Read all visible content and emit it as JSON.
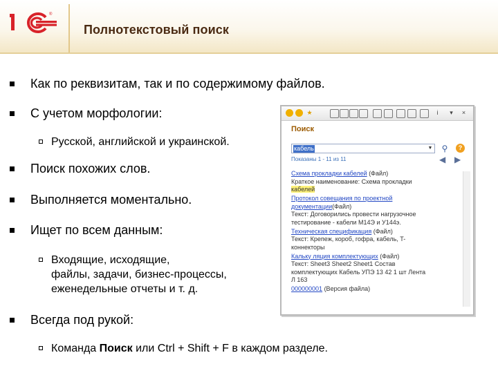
{
  "header": {
    "title": "Полнотекстовый поиск"
  },
  "bullets": [
    "Как по реквизитам, так и по содержимому файлов.",
    "С учетом морфологии:",
    "Поиск похожих слов.",
    "Выполняется моментально.",
    "Ищет по всем данным:",
    "Всегда под рукой:"
  ],
  "subbullets": {
    "morph": "Русской, английской и украинской.",
    "data_l1": "Входящие, исходящие,",
    "data_l2": "файлы, задачи, бизнес-процессы,",
    "data_l3": "еженедельные отчеты и т. д.",
    "cmd_pre": "Команда ",
    "cmd_bold": "Поиск",
    "cmd_post": " или Ctrl + Shift + F в каждом разделе."
  },
  "window": {
    "title": "Поиск",
    "search_value": "кабель",
    "count": "Показаны 1 - 11 из 11",
    "results": [
      {
        "link": "Схема прокладки кабелей",
        "tag": " (Файл)",
        "lines": [
          "Краткое наименование: Схема прокладки",
          "кабелей"
        ]
      },
      {
        "link": "Протокол совещания по проектной",
        "tag": "",
        "lines": [
          "документации",
          "(Файл)",
          "Текст: Договорились провести нагрузочное",
          "тестирование - кабели М14Э и У144э."
        ]
      },
      {
        "link": "Техническая спецификация",
        "tag": " (Файл)",
        "lines": [
          "Текст: Крепеж, короб, гофра, кабель, T-",
          "коннекторы"
        ]
      },
      {
        "link": "Кальку ляция комплектующих",
        "tag": " (Файл)",
        "lines": [
          "Текст: Sheet3 Sheet2 Sheet1 Состав",
          "комплектующих Кабель УПЭ 13 42 1 шт Лента",
          "Л 163"
        ]
      },
      {
        "link": "000000001",
        "tag": " (Версия файла)",
        "lines": []
      }
    ]
  },
  "colors": {
    "accent": "#d8232a",
    "title": "#4a2a12",
    "link": "#2348c4",
    "highlight": "#fff27a"
  }
}
